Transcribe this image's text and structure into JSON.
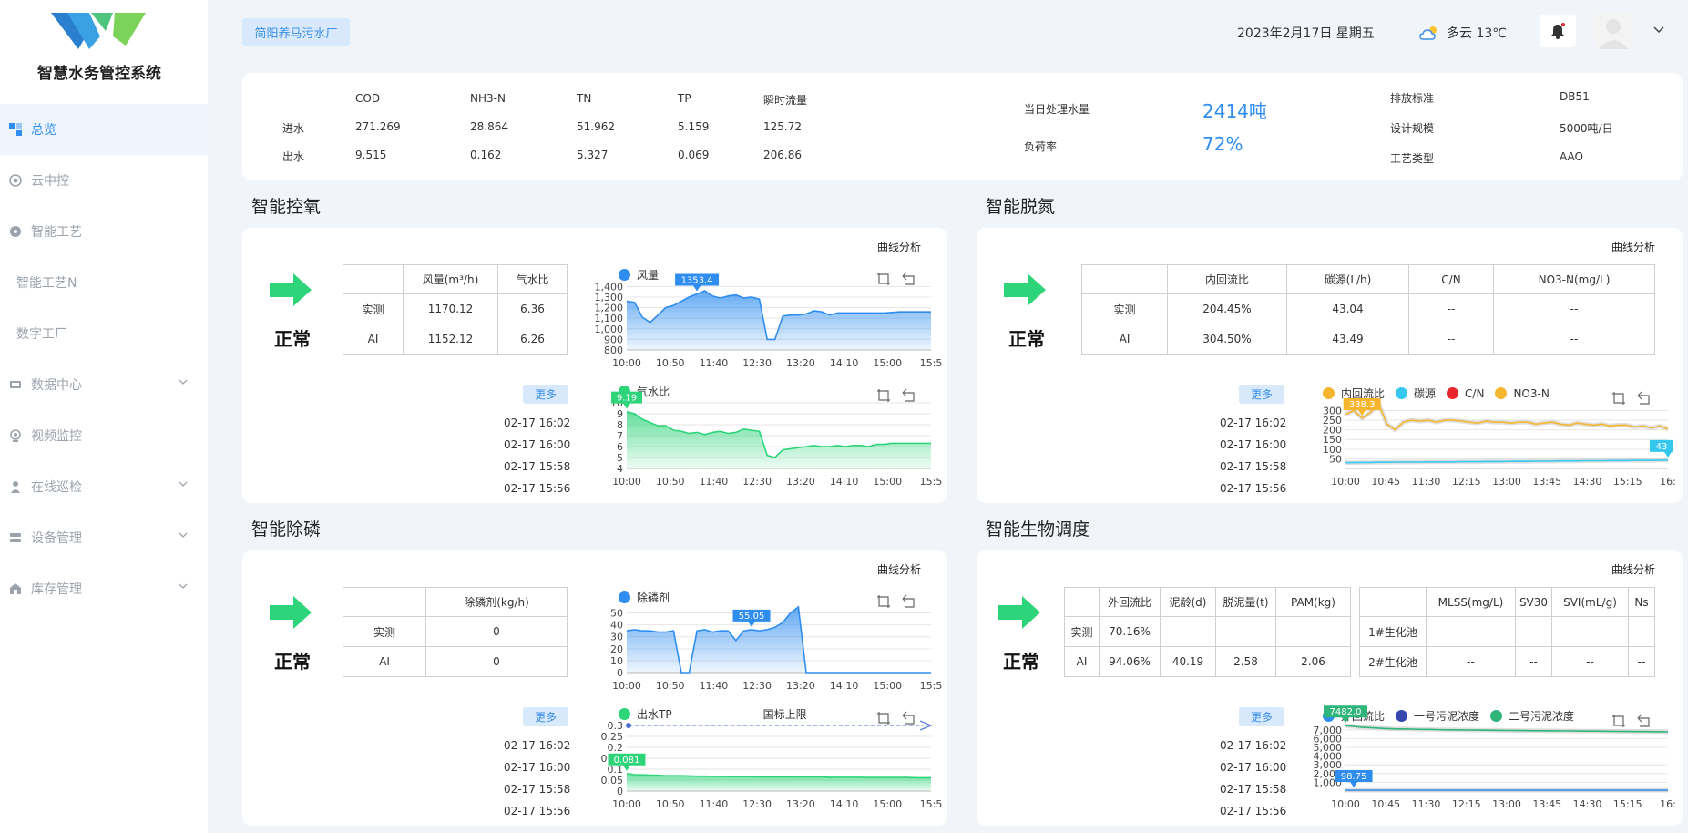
{
  "app": {
    "title": "智慧水务管控系统"
  },
  "sidebar": {
    "items": [
      {
        "label": "总览",
        "icon": "overview-icon",
        "active": true
      },
      {
        "label": "云中控",
        "icon": "cloud-control-icon"
      },
      {
        "label": "智能工艺",
        "icon": "process-icon"
      },
      {
        "label": "智能工艺N",
        "icon": ""
      },
      {
        "label": "数字工厂",
        "icon": ""
      },
      {
        "label": "数据中心",
        "icon": "data-center-icon",
        "expandable": true
      },
      {
        "label": "视频监控",
        "icon": "video-icon"
      },
      {
        "label": "在线巡检",
        "icon": "inspection-icon",
        "expandable": true
      },
      {
        "label": "设备管理",
        "icon": "device-icon",
        "expandable": true
      },
      {
        "label": "库存管理",
        "icon": "inventory-icon",
        "expandable": true
      }
    ]
  },
  "header": {
    "plant": "简阳养马污水厂",
    "date": "2023年2月17日 星期五",
    "weather": "多云 13℃"
  },
  "summary": {
    "headers": [
      "COD",
      "NH3-N",
      "TN",
      "TP",
      "瞬时流量"
    ],
    "rows": [
      {
        "label": "进水",
        "values": [
          "271.269",
          "28.864",
          "51.962",
          "5.159",
          "125.72"
        ]
      },
      {
        "label": "出水",
        "values": [
          "9.515",
          "0.162",
          "5.327",
          "0.069",
          "206.86"
        ]
      }
    ],
    "daily_label": "当日处理水量",
    "daily_value": "2414吨",
    "load_label": "负荷率",
    "load_value": "72%",
    "standard_label": "排放标准",
    "standard_value": "DB51",
    "scale_label": "设计规模",
    "scale_value": "5000吨/日",
    "process_label": "工艺类型",
    "process_value": "AAO"
  },
  "common": {
    "curve_link": "曲线分析",
    "status": "正常",
    "more": "更多",
    "measured": "实测",
    "ai": "AI"
  },
  "oxygen": {
    "title": "智能控氧",
    "headers": [
      "风量(m³/h)",
      "气水比"
    ],
    "measured": [
      "1170.12",
      "6.36"
    ],
    "ai": [
      "1152.12",
      "6.26"
    ],
    "log": [
      "02-17 16:02",
      "02-17 16:00",
      "02-17 15:58",
      "02-17 15:56"
    ]
  },
  "nitrogen": {
    "title": "智能脱氮",
    "headers": [
      "内回流比",
      "碳源(L/h)",
      "C/N",
      "NO3-N(mg/L)"
    ],
    "measured": [
      "204.45%",
      "43.04",
      "--",
      "--"
    ],
    "ai": [
      "304.50%",
      "43.49",
      "--",
      "--"
    ],
    "log": [
      "02-17 16:02",
      "02-17 16:00",
      "02-17 15:58",
      "02-17 15:56"
    ]
  },
  "phosphorus": {
    "title": "智能除磷",
    "headers": [
      "除磷剂(kg/h)"
    ],
    "measured": [
      "0"
    ],
    "ai": [
      "0"
    ],
    "log": [
      "02-17 16:02",
      "02-17 16:00",
      "02-17 15:58",
      "02-17 15:56"
    ]
  },
  "bio": {
    "title": "智能生物调度",
    "headers1": [
      "外回流比",
      "泥龄(d)",
      "脱泥量(t)",
      "PAM(kg)"
    ],
    "measured": [
      "70.16%",
      "--",
      "--",
      "--"
    ],
    "ai": [
      "94.06%",
      "40.19",
      "2.58",
      "2.06"
    ],
    "headers2": [
      "MLSS(mg/L)",
      "SV30",
      "SVI(mL/g)",
      "Ns"
    ],
    "pool1": {
      "label": "1#生化池",
      "values": [
        "--",
        "--",
        "--",
        "--"
      ]
    },
    "pool2": {
      "label": "2#生化池",
      "values": [
        "--",
        "--",
        "--",
        "--"
      ]
    },
    "log": [
      "02-17 16:02",
      "02-17 16:00",
      "02-17 15:58",
      "02-17 15:56"
    ]
  },
  "colors": {
    "blue": "#2f8df0",
    "green": "#2ed47a",
    "orange": "#f5b52e",
    "cyan": "#35c8ee",
    "red": "#e8262b",
    "navy": "#3647b0",
    "teal": "#2fb47a"
  },
  "chart_data": [
    {
      "id": "oxygen_air",
      "type": "area",
      "legend": [
        "风量"
      ],
      "x": [
        "10:00",
        "10:50",
        "11:40",
        "12:30",
        "13:20",
        "14:10",
        "15:00",
        "15:5"
      ],
      "yticks": [
        800,
        900,
        1000,
        1100,
        1200,
        1300,
        1400
      ],
      "ylim": [
        800,
        1420
      ],
      "marker": {
        "label": "1353.4",
        "at": 0.22
      },
      "series": [
        {
          "name": "风量",
          "color": "#2f8df0",
          "values": [
            1260,
            1250,
            1110,
            1060,
            1130,
            1200,
            1220,
            1260,
            1300,
            1330,
            1360,
            1310,
            1290,
            1310,
            1320,
            1290,
            1300,
            1280,
            900,
            900,
            1120,
            1130,
            1130,
            1140,
            1170,
            1160,
            1130,
            1150,
            1150,
            1150,
            1150,
            1150,
            1150,
            1150,
            1155,
            1160,
            1160,
            1160,
            1160,
            1160
          ]
        }
      ]
    },
    {
      "id": "oxygen_ratio",
      "type": "area",
      "legend": [
        "气水比"
      ],
      "x": [
        "10:00",
        "10:50",
        "11:40",
        "12:30",
        "13:20",
        "14:10",
        "15:00",
        "15:5"
      ],
      "yticks": [
        4,
        5,
        6,
        7,
        8,
        9,
        10
      ],
      "ylim": [
        4,
        10
      ],
      "marker": {
        "label": "9.19",
        "at": 0.0
      },
      "series": [
        {
          "name": "气水比",
          "color": "#2ed47a",
          "values": [
            9.2,
            9.0,
            8.5,
            8.2,
            7.9,
            7.9,
            7.5,
            7.4,
            7.2,
            7.3,
            7.1,
            7.3,
            7.4,
            7.2,
            7.3,
            7.6,
            7.5,
            7.4,
            5.2,
            5.0,
            5.7,
            5.8,
            5.9,
            6.0,
            6.1,
            6.0,
            6.0,
            6.1,
            6.0,
            6.1,
            6.1,
            6.0,
            6.2,
            6.2,
            6.3,
            6.3,
            6.3,
            6.3,
            6.3,
            6.3
          ]
        }
      ]
    },
    {
      "id": "nitrogen_multi",
      "type": "line",
      "legend": [
        "内回流比",
        "碳源",
        "C/N",
        "NO3-N"
      ],
      "x": [
        "10:00",
        "10:45",
        "11:30",
        "12:15",
        "13:00",
        "13:45",
        "14:30",
        "15:15",
        "16:"
      ],
      "yticks": [
        50,
        100,
        150,
        200,
        250,
        300
      ],
      "ylim": [
        0,
        340
      ],
      "marker": {
        "label": "338.3",
        "at": 0.06
      },
      "marker2": {
        "label": "43",
        "at": 1.0
      },
      "series": [
        {
          "name": "内回流比",
          "color": "#f5b52e",
          "values": [
            280,
            300,
            260,
            290,
            338,
            230,
            200,
            240,
            250,
            245,
            250,
            240,
            250,
            250,
            245,
            240,
            235,
            245,
            240,
            240,
            235,
            240,
            240,
            230,
            235,
            240,
            230,
            225,
            235,
            230,
            225,
            230,
            220,
            225,
            225,
            215,
            220,
            210,
            220,
            205
          ]
        },
        {
          "name": "碳源",
          "color": "#35c8ee",
          "values": [
            30,
            30,
            31,
            31,
            32,
            32,
            33,
            33,
            33,
            33,
            34,
            34,
            34,
            34,
            35,
            35,
            35,
            36,
            36,
            36,
            37,
            37,
            37,
            38,
            38,
            38,
            39,
            39,
            39,
            40,
            40,
            40,
            41,
            41,
            41,
            42,
            42,
            42,
            43,
            43
          ]
        }
      ]
    },
    {
      "id": "phosphorus_agent",
      "type": "area",
      "legend": [
        "除磷剂"
      ],
      "x": [
        "10:00",
        "10:50",
        "11:40",
        "12:30",
        "13:20",
        "14:10",
        "15:00",
        "15:5"
      ],
      "yticks": [
        0,
        10,
        20,
        30,
        40,
        50
      ],
      "ylim": [
        0,
        55
      ],
      "marker": {
        "label": "55.05",
        "at": 0.42
      },
      "series": [
        {
          "name": "除磷剂",
          "color": "#2f8df0",
          "values": [
            35,
            36,
            35,
            35,
            34,
            34,
            35,
            0,
            0,
            35,
            36,
            34,
            35,
            35,
            27,
            35,
            36,
            35,
            36,
            38,
            42,
            50,
            55,
            0,
            0,
            0,
            0,
            0,
            0,
            0,
            0,
            0,
            0,
            0,
            0,
            0,
            0,
            0,
            0,
            0
          ]
        }
      ]
    },
    {
      "id": "phosphorus_tp",
      "type": "area",
      "legend": [
        "出水TP"
      ],
      "x": [
        "10:00",
        "10:50",
        "11:40",
        "12:30",
        "13:20",
        "14:10",
        "15:00",
        "15:5"
      ],
      "yticks": [
        0,
        0.05,
        0.1,
        0.15,
        0.2,
        0.25,
        0.3
      ],
      "ytick_labels": [
        "0",
        "0.05",
        "0.1",
        "0.15",
        "0.2",
        "0.25",
        "0.3"
      ],
      "ylim": [
        0,
        0.3
      ],
      "threshold": {
        "label": "国标上限",
        "value": 0.3
      },
      "marker": {
        "label": "0.081",
        "at": 0.0
      },
      "series": [
        {
          "name": "出水TP",
          "color": "#2ed47a",
          "values": [
            0.08,
            0.075,
            0.074,
            0.073,
            0.072,
            0.07,
            0.07,
            0.07,
            0.069,
            0.068,
            0.068,
            0.067,
            0.067,
            0.066,
            0.066,
            0.066,
            0.066,
            0.065,
            0.065,
            0.065,
            0.065,
            0.064,
            0.064,
            0.064,
            0.064,
            0.064,
            0.063,
            0.063,
            0.063,
            0.063,
            0.063,
            0.062,
            0.062,
            0.062,
            0.062,
            0.062,
            0.062,
            0.061,
            0.061,
            0.061
          ]
        }
      ]
    },
    {
      "id": "bio_multi",
      "type": "line",
      "legend": [
        "外回流比",
        "一号污泥浓度",
        "二号污泥浓度"
      ],
      "x": [
        "10:00",
        "10:45",
        "11:30",
        "12:15",
        "13:00",
        "13:45",
        "14:30",
        "15:15",
        "16:"
      ],
      "yticks": [
        1000,
        2000,
        3000,
        4000,
        5000,
        6000,
        7000
      ],
      "ytick_labels": [
        "1,000",
        "2,000",
        "3,000",
        "4,000",
        "5,000",
        "6,000",
        "7,000"
      ],
      "ylim": [
        0,
        7500
      ],
      "marker": {
        "label": "7482.0",
        "at": 0.0
      },
      "marker2": {
        "label": "98.75",
        "at": 0.02
      },
      "series": [
        {
          "name": "二号污泥浓度",
          "color": "#2fb47a",
          "values": [
            7480,
            7400,
            7300,
            7250,
            7200,
            7150,
            7100,
            7100,
            7080,
            7050,
            7050,
            7030,
            7000,
            7000,
            6990,
            6980,
            6970,
            6960,
            6950,
            6940,
            6930,
            6920,
            6910,
            6900,
            6900,
            6890,
            6880,
            6870,
            6860,
            6850,
            6850,
            6840,
            6830,
            6820,
            6810,
            6800,
            6800,
            6790,
            6780,
            6770
          ]
        },
        {
          "name": "外回流比",
          "color": "#2f8df0",
          "values": [
            99,
            99,
            99,
            99,
            99,
            99,
            99,
            99,
            99,
            99,
            99,
            99,
            99,
            99,
            99,
            99,
            99,
            99,
            99,
            99,
            99,
            99,
            99,
            99,
            99,
            99,
            99,
            99,
            99,
            99,
            99,
            99,
            99,
            99,
            99,
            99,
            99,
            99,
            99,
            99
          ]
        }
      ]
    }
  ]
}
